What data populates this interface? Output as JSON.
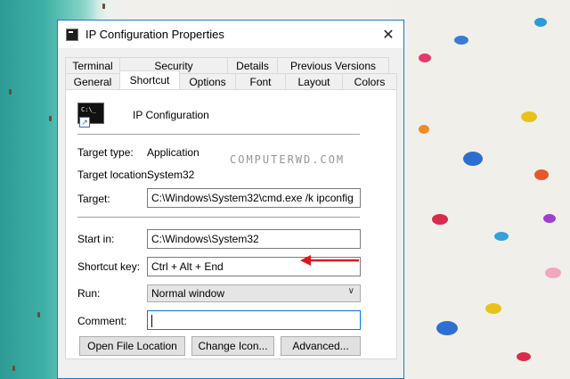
{
  "window": {
    "title": "IP Configuration Properties",
    "close_glyph": "✕"
  },
  "tabs_row1": [
    "Terminal",
    "Security",
    "Details",
    "Previous Versions"
  ],
  "tabs_row2": [
    "General",
    "Shortcut",
    "Options",
    "Font",
    "Layout",
    "Colors"
  ],
  "active_tab": "Shortcut",
  "app": {
    "name": "IP Configuration",
    "icon_text": "C:\\_",
    "icon": "console-icon"
  },
  "fields": {
    "target_type": {
      "label": "Target type:",
      "value": "Application"
    },
    "target_location": {
      "label": "Target location:",
      "value": "System32"
    },
    "target": {
      "label": "Target:",
      "value": "C:\\Windows\\System32\\cmd.exe /k ipconfig"
    },
    "start_in": {
      "label": "Start in:",
      "value": "C:\\Windows\\System32"
    },
    "shortcut_key": {
      "label": "Shortcut key:",
      "value": "Ctrl + Alt + End"
    },
    "run": {
      "label": "Run:",
      "value": "Normal window"
    },
    "comment": {
      "label": "Comment:",
      "value": ""
    }
  },
  "buttons": {
    "open_file_location": "Open File Location",
    "change_icon": "Change Icon...",
    "advanced": "Advanced..."
  },
  "watermark": "COMPUTERWD.COM",
  "colors": {
    "accent": "#0078d7",
    "annotation_arrow": "#e0141e"
  }
}
